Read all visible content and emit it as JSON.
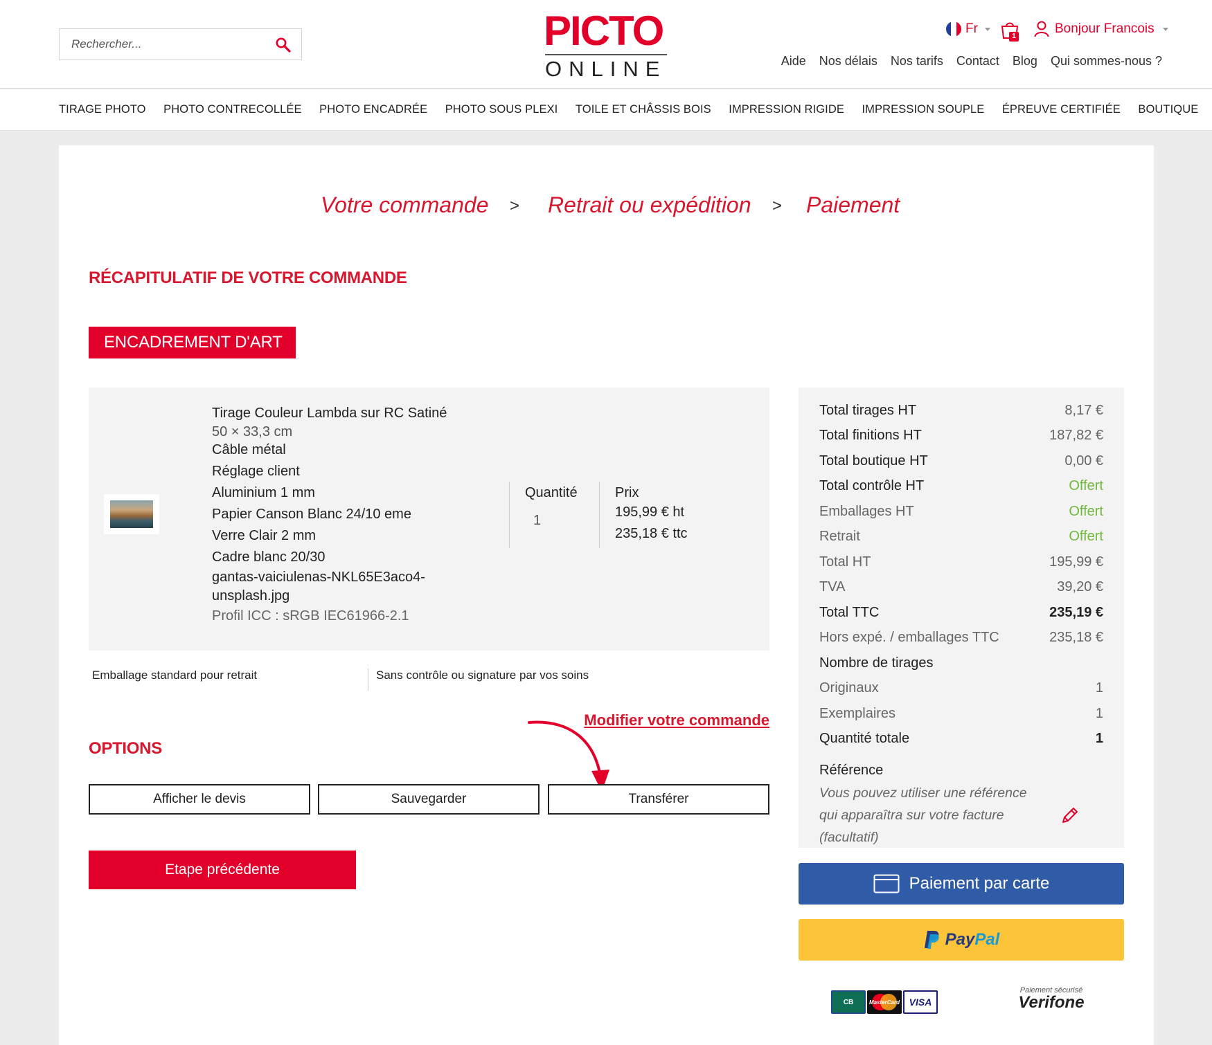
{
  "search": {
    "placeholder": "Rechercher..."
  },
  "logo": {
    "top": "PICTO",
    "bottom": "ONLINE"
  },
  "header": {
    "lang": "Fr",
    "cart_count": "1",
    "account": "Bonjour Francois",
    "links": [
      "Aide",
      "Nos délais",
      "Nos tarifs",
      "Contact",
      "Blog",
      "Qui sommes-nous ?"
    ]
  },
  "nav": [
    "TIRAGE PHOTO",
    "PHOTO CONTRECOLLÉE",
    "PHOTO ENCADRÉE",
    "PHOTO SOUS PLEXI",
    "TOILE ET CHÂSSIS BOIS",
    "IMPRESSION RIGIDE",
    "IMPRESSION SOUPLE",
    "ÉPREUVE CERTIFIÉE",
    "BOUTIQUE"
  ],
  "steps": {
    "step1": "Votre commande",
    "step2": "Retrait ou expédition",
    "step3": "Paiement",
    "separator": ">"
  },
  "recap_title": "RÉCAPITULATIF DE VOTRE COMMANDE",
  "category": "ENCADREMENT D'ART",
  "item": {
    "name": "Tirage Couleur Lambda sur RC Satiné",
    "size": "50 × 33,3 cm",
    "options": [
      "Câble métal",
      "Réglage client",
      "Aluminium 1 mm",
      "Papier Canson Blanc 24/10 eme",
      "Verre Clair 2 mm",
      "Cadre blanc 20/30"
    ],
    "filename_1": "gantas-vaiciulenas-NKL65E3aco4-",
    "filename_2": "unsplash.jpg",
    "icc": "Profil ICC : sRGB IEC61966-2.1",
    "qty_label": "Quantité",
    "qty": "1",
    "price_label": "Prix",
    "price_ht": "195,99 € ht",
    "price_ttc": "235,18 € ttc"
  },
  "packaging": "Emballage standard pour retrait",
  "control": "Sans contrôle ou signature par vos soins",
  "modify_link": "Modifier votre commande",
  "options_title": "OPTIONS",
  "option_buttons": {
    "devis": "Afficher le devis",
    "save": "Sauvegarder",
    "transfer": "Transférer"
  },
  "prev_step": "Etape précédente",
  "summary": {
    "rows": [
      {
        "label": "Total tirages HT",
        "value": "8,17 €"
      },
      {
        "label": "Total finitions HT",
        "value": "187,82 €"
      },
      {
        "label": "Total boutique HT",
        "value": "0,00 €"
      },
      {
        "label": "Total contrôle HT",
        "value": "Offert"
      },
      {
        "label": "Emballages HT",
        "value": "Offert"
      },
      {
        "label": "Retrait",
        "value": "Offert"
      },
      {
        "label": "Total HT",
        "value": "195,99 €"
      },
      {
        "label": "TVA",
        "value": "39,20 €"
      },
      {
        "label": "Total TTC",
        "value": "235,19 €"
      },
      {
        "label": "Hors expé. / emballages TTC",
        "value": "235,18 €"
      },
      {
        "label": "Nombre de tirages",
        "value": ""
      },
      {
        "label": "Originaux",
        "value": "1"
      },
      {
        "label": "Exemplaires",
        "value": "1"
      },
      {
        "label": "Quantité totale",
        "value": "1"
      }
    ],
    "reference_title": "Référence",
    "reference_hint": "Vous pouvez utiliser une référence qui apparaîtra sur votre facture (facultatif)"
  },
  "payment": {
    "card": "Paiement par carte",
    "paypal_1": "Pay",
    "paypal_2": "Pal",
    "cb": "CB",
    "mastercard": "MasterCard",
    "visa": "VISA",
    "secure": "Paiement sécurisé",
    "verifone": "Verifone"
  },
  "colors": {
    "brand_red": "#e2002b",
    "offer_green": "#6fb83b",
    "card_blue": "#2f5ba7",
    "paypal_yellow": "#fcc439"
  }
}
